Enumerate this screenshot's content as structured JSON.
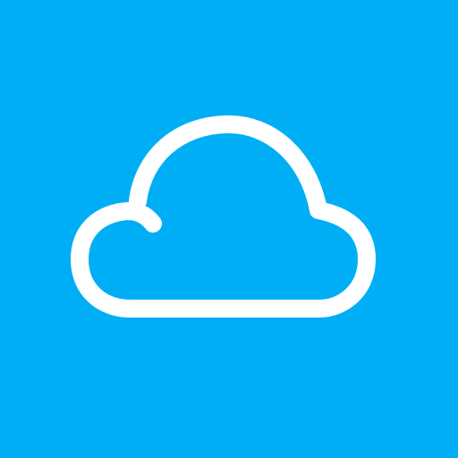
{
  "icon": {
    "name": "cloud-icon",
    "background_color": "#00AEF6",
    "stroke_color": "#FFFFFF"
  }
}
